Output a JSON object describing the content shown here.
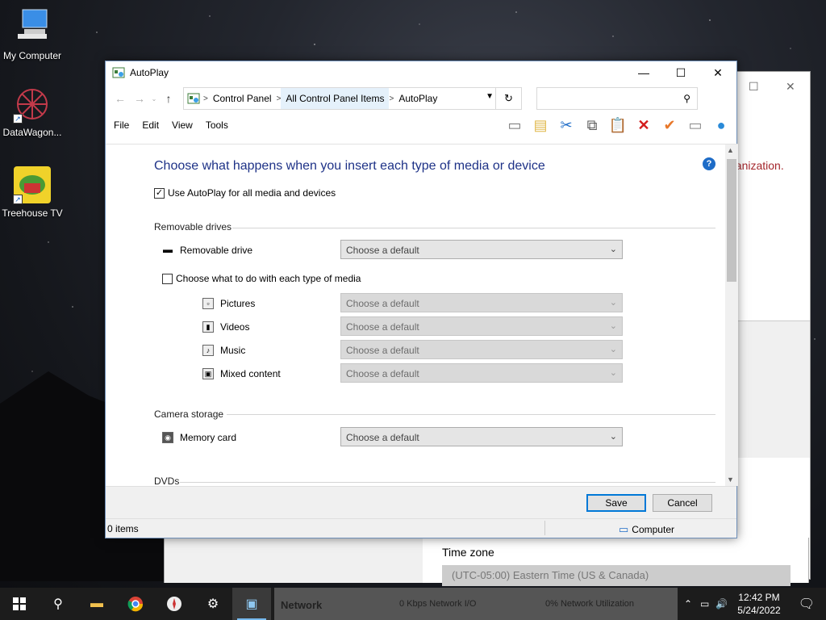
{
  "desktop": {
    "icons": [
      {
        "label": "My Computer"
      },
      {
        "label": "DataWagon..."
      },
      {
        "label": "Treehouse TV"
      }
    ]
  },
  "background_window": {
    "red_text": "ganization.",
    "timezone_label": "Time zone",
    "timezone_value": "(UTC-05:00) Eastern Time (US & Canada)"
  },
  "window": {
    "title": "AutoPlay",
    "breadcrumbs": [
      "Control Panel",
      "All Control Panel Items",
      "AutoPlay"
    ],
    "search_placeholder": "",
    "menus": [
      "File",
      "Edit",
      "View",
      "Tools"
    ],
    "heading": "Choose what happens when you insert each type of media or device",
    "use_autoplay_label": "Use AutoPlay for all media and devices",
    "use_autoplay_checked": true,
    "sections": {
      "removable": "Removable drives",
      "camera": "Camera storage",
      "dvds": "DVDs"
    },
    "removable_drive_label": "Removable drive",
    "per_media_label": "Choose what to do with each type of media",
    "per_media_checked": false,
    "media_types": [
      {
        "label": "Pictures",
        "icon": "picture-file-icon"
      },
      {
        "label": "Videos",
        "icon": "video-file-icon"
      },
      {
        "label": "Music",
        "icon": "music-file-icon"
      },
      {
        "label": "Mixed content",
        "icon": "mixed-content-icon"
      }
    ],
    "memory_card_label": "Memory card",
    "default_option": "Choose a default",
    "save_label": "Save",
    "cancel_label": "Cancel",
    "status_items": "0 items",
    "status_location": "Computer"
  },
  "taskbar": {
    "strip_items": [
      "Network",
      "0 Kbps Network I/O",
      "0% Network Utilization"
    ],
    "time": "12:42 PM",
    "date": "5/24/2022"
  },
  "colors": {
    "heading": "#1e3287",
    "accent": "#0078d7",
    "error_red": "#a4262c"
  }
}
